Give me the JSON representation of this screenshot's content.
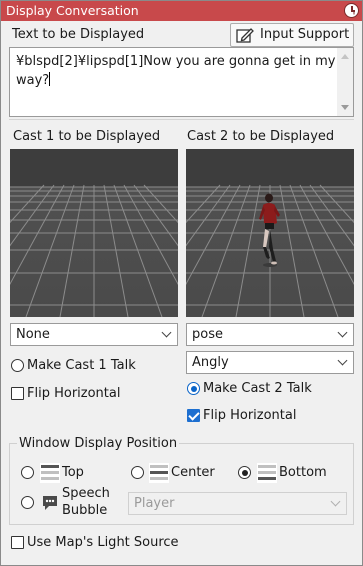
{
  "window": {
    "title": "Display Conversation",
    "clock_icon": "clock-icon"
  },
  "text_section": {
    "label": "Text to be Displayed",
    "input_support_label": "Input Support",
    "input_support_icon": "edit-icon",
    "text_value": "¥blspd[2]¥lipspd[1]Now you are gonna get in my way?"
  },
  "cast1": {
    "header": "Cast 1 to be Displayed",
    "character_select": "None",
    "talk_label": "Make Cast 1 Talk",
    "talk_checked": false,
    "flip_label": "Flip Horizontal",
    "flip_checked": false
  },
  "cast2": {
    "header": "Cast 2 to be Displayed",
    "character_select": "pose",
    "expression_select": "Angly",
    "talk_label": "Make Cast 2 Talk",
    "talk_checked": true,
    "flip_label": "Flip Horizontal",
    "flip_checked": true
  },
  "window_position": {
    "group_label": "Window Display Position",
    "options": [
      {
        "label": "Top",
        "icon": "window-top-icon",
        "selected": false
      },
      {
        "label": "Center",
        "icon": "window-center-icon",
        "selected": false
      },
      {
        "label": "Bottom",
        "icon": "window-bottom-icon",
        "selected": true
      },
      {
        "label_line1": "Speech",
        "label_line2": "Bubble",
        "icon": "speech-bubble-icon",
        "selected": false
      }
    ],
    "bubble_target_select": "Player"
  },
  "light_source": {
    "label": "Use Map's Light Source",
    "checked": false
  },
  "colors": {
    "titlebar": "#c8494b",
    "accent": "#0a64c8",
    "check_fill": "#1d6fd0",
    "viewport_bg": "#4a4a4a"
  }
}
